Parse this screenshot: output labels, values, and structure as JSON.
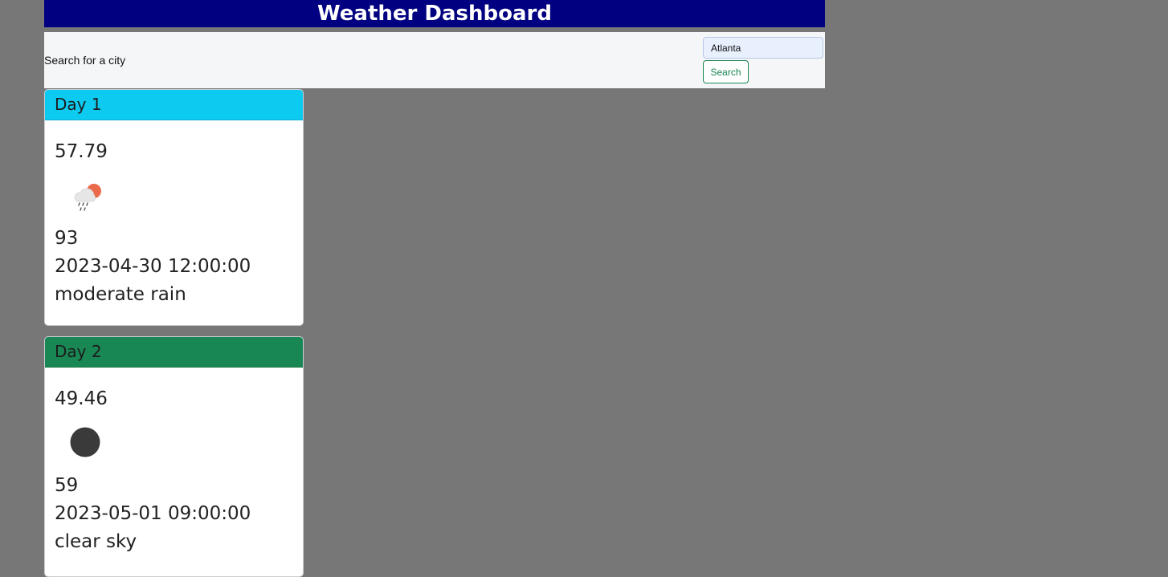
{
  "header": {
    "title": "Weather Dashboard"
  },
  "search": {
    "label": "Search for a city",
    "value": "Atlanta",
    "button_label": "Search"
  },
  "colors": {
    "header_bg": "#000080",
    "day1_header": "#0dcaf0",
    "day2_header": "#198754",
    "page_bg": "#777777"
  },
  "forecast": [
    {
      "label": "Day 1",
      "temp": "57.79",
      "icon": "rain-sun-icon",
      "humidity": "93",
      "datetime": "2023-04-30 12:00:00",
      "description": "moderate rain"
    },
    {
      "label": "Day 2",
      "temp": "49.46",
      "icon": "clear-night-icon",
      "humidity": "59",
      "datetime": "2023-05-01 09:00:00",
      "description": "clear sky"
    }
  ]
}
